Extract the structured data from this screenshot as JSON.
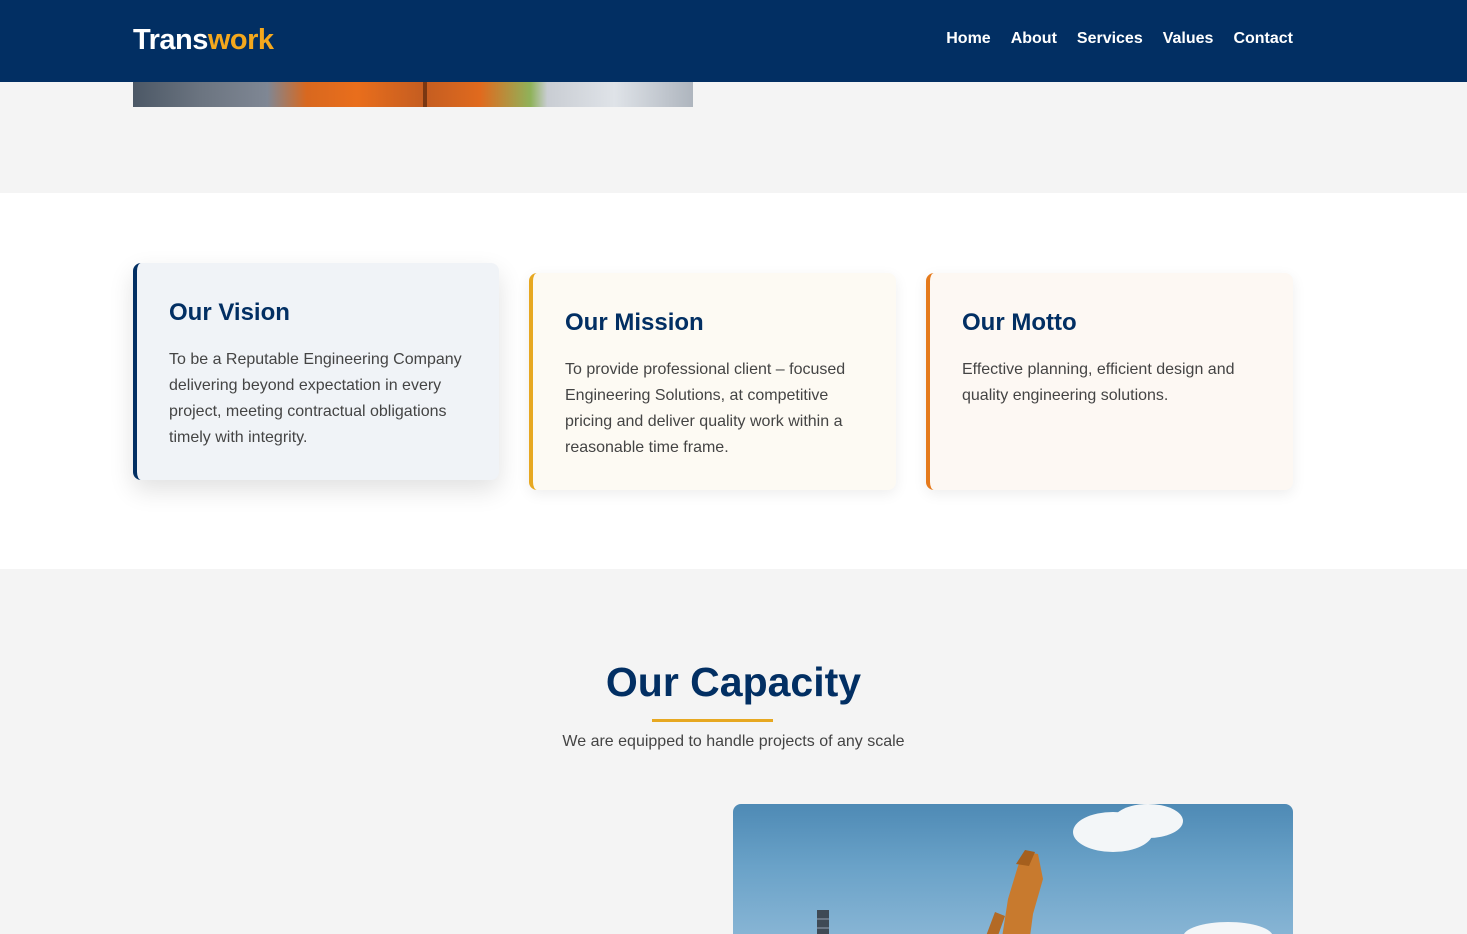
{
  "brand": {
    "part1": "Trans",
    "part2": "work"
  },
  "nav": {
    "items": [
      "Home",
      "About",
      "Services",
      "Values",
      "Contact"
    ]
  },
  "cards": [
    {
      "title": "Our Vision",
      "text": "To be a Reputable Engineering Company delivering beyond expectation in every project, meeting contractual obligations timely with integrity."
    },
    {
      "title": "Our Mission",
      "text": "To provide professional client – focused Engineering Solutions, at competitive pricing and deliver quality work within a reasonable time frame."
    },
    {
      "title": "Our Motto",
      "text": "Effective planning, efficient design and quality engineering solutions."
    }
  ],
  "capacity": {
    "title": "Our Capacity",
    "subtitle": "We are equipped to handle projects of any scale"
  },
  "colors": {
    "navy": "#022f63",
    "gold": "#f4a81d",
    "amber": "#e7a821",
    "orange": "#e57a1c"
  }
}
